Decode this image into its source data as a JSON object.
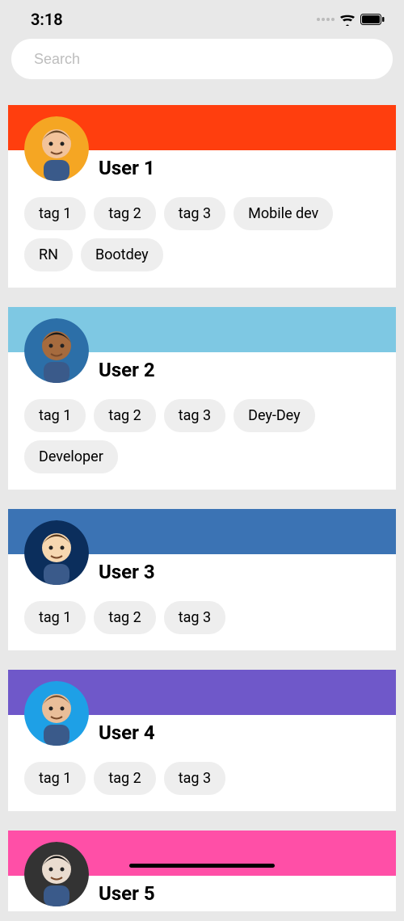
{
  "status": {
    "time": "3:18"
  },
  "search": {
    "placeholder": "Search"
  },
  "users": [
    {
      "name": "User 1",
      "header_color": "#FF3E0E",
      "avatar_bg": "#F5A623",
      "tags": [
        "tag 1",
        "tag 2",
        "tag 3",
        "Mobile dev",
        "RN",
        "Bootdey"
      ]
    },
    {
      "name": "User 2",
      "header_color": "#7EC8E3",
      "avatar_bg": "#2C6FA8",
      "tags": [
        "tag 1",
        "tag 2",
        "tag 3",
        "Dey-Dey",
        "Developer"
      ]
    },
    {
      "name": "User 3",
      "header_color": "#3B73B4",
      "avatar_bg": "#0B2E5C",
      "tags": [
        "tag 1",
        "tag 2",
        "tag 3"
      ]
    },
    {
      "name": "User 4",
      "header_color": "#6F58C9",
      "avatar_bg": "#1EA0E6",
      "tags": [
        "tag 1",
        "tag 2",
        "tag 3"
      ]
    },
    {
      "name": "User 5",
      "header_color": "#FF4FA7",
      "avatar_bg": "#333333",
      "tags": []
    }
  ]
}
